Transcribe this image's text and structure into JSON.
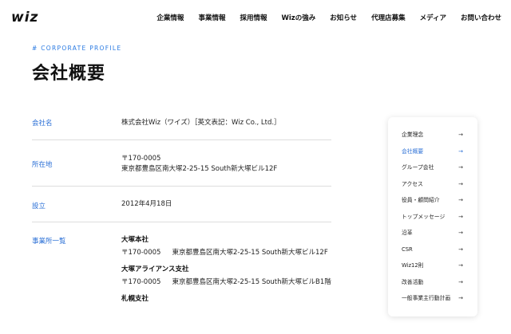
{
  "header": {
    "logo": "wiz",
    "nav": [
      "企業情報",
      "事業情報",
      "採用情報",
      "Wizの強み",
      "お知らせ",
      "代理店募集",
      "メディア",
      "お問い合わせ"
    ]
  },
  "page": {
    "eyebrow": "# CORPORATE PROFILE",
    "title": "会社概要"
  },
  "profile": {
    "company_label": "会社名",
    "company_value": "株式会社Wiz（ワイズ）［英文表記：Wiz Co., Ltd.］",
    "address_label": "所在地",
    "address_zip": "〒170-0005",
    "address_line": "東京都豊島区南大塚2-25-15 South新大塚ビル12F",
    "founded_label": "設立",
    "founded_value": "2012年4月18日",
    "offices_label": "事業所一覧",
    "offices": [
      {
        "name": "大塚本社",
        "zip": "〒170-0005",
        "addr": "東京都豊島区南大塚2-25-15 South新大塚ビル12F"
      },
      {
        "name": "大塚アライアンス支社",
        "zip": "〒170-0005",
        "addr": "東京都豊島区南大塚2-25-15 South新大塚ビルB1階"
      },
      {
        "name": "札幌支社"
      }
    ]
  },
  "sidebar": {
    "items": [
      "企業理念",
      "会社概要",
      "グループ会社",
      "アクセス",
      "役員・顧問紹介",
      "トップメッセージ",
      "沿革",
      "CSR",
      "Wiz12則",
      "改善活動",
      "一般事業主行動計画"
    ],
    "active_index": 1,
    "arrow": "→",
    "accent_color": "#2a6fd6"
  }
}
